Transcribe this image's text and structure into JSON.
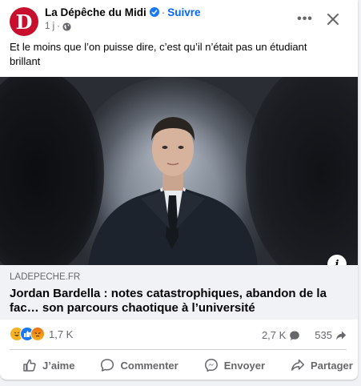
{
  "post": {
    "page_name": "La Dépêche du Midi",
    "avatar_letter": "D",
    "separator": "·",
    "follow_label": "Suivre",
    "time": "1 j",
    "meta_separator": "·",
    "text": "Et le moins que l’on puisse dire, c’est qu’il n’était pas un étudiant brillant"
  },
  "link": {
    "domain": "LADEPECHE.FR",
    "headline": "Jordan Bardella : notes catastrophiques, abandon de la fac… son parcours chaotique à l’université",
    "info_label": "i"
  },
  "reactions": {
    "types": [
      "haha-icon",
      "like-icon",
      "angry-icon"
    ],
    "count": "1,7 K",
    "comments": "2,7 K",
    "shares": "535"
  },
  "actions": {
    "like": "J’aime",
    "comment": "Commenter",
    "send": "Envoyer",
    "share": "Partager"
  },
  "colors": {
    "brand_red": "#c8102e",
    "facebook_blue": "#0866ff",
    "secondary_text": "#65676b"
  }
}
